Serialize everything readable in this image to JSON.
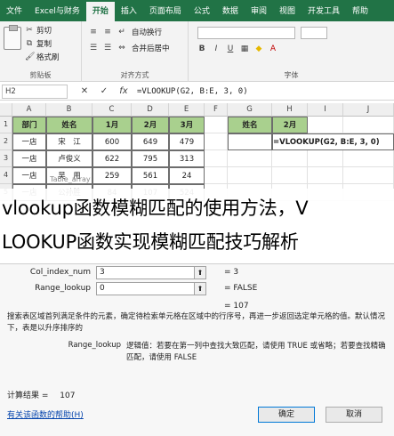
{
  "tabs": [
    "文件",
    "Excel与财务",
    "开始",
    "插入",
    "页面布局",
    "公式",
    "数据",
    "审阅",
    "视图",
    "开发工具",
    "帮助"
  ],
  "ribbon": {
    "clipboard": {
      "cut": "剪切",
      "copy": "复制",
      "format_painter": "格式刷",
      "group_label": "剪贴板"
    },
    "font": {
      "row1_items": [
        "合并后居中"
      ],
      "row2_items": [
        "自动换行"
      ],
      "align_label": "对齐方式",
      "font_label": "字体"
    }
  },
  "formula_bar": {
    "name_box": "H2",
    "cancel": "✕",
    "enter": "✓",
    "fx": "fx",
    "formula": "=VLOOKUP(G2, B:E, 3, 0)"
  },
  "columns": [
    "A",
    "B",
    "C",
    "D",
    "E",
    "F",
    "G",
    "H",
    "I",
    "J"
  ],
  "rows": [
    "1",
    "2",
    "3",
    "4",
    "5"
  ],
  "table": {
    "headers": [
      "部门",
      "姓名",
      "1月",
      "2月",
      "3月"
    ],
    "data": [
      [
        "一店",
        "宋　江",
        "600",
        "649",
        "479"
      ],
      [
        "一店",
        "卢俊义",
        "622",
        "795",
        "313"
      ],
      [
        "一店",
        "吴　用",
        "259",
        "561",
        "24"
      ],
      [
        "一店",
        "公孙胜",
        "84",
        "107",
        "524"
      ]
    ]
  },
  "lookup": {
    "g_header": "姓名",
    "h_header": "2月",
    "h_formula": "=VLOOKUP(G2, B:E, 3, 0)"
  },
  "overlay": {
    "line1": "vlookup函数模糊匹配的使用方法，V",
    "line2": "LOOKUP函数实现模糊匹配技巧解析"
  },
  "dialog": {
    "partial_arg": "Table_array",
    "args": [
      {
        "label": "Col_index_num",
        "value": "3",
        "result": "=  3"
      },
      {
        "label": "Range_lookup",
        "value": "0",
        "result": "=  FALSE"
      }
    ],
    "total_result": "=  107",
    "desc_main": "搜索表区域首列满足条件的元素，确定待检索单元格在区域中的行序号，再进一步返回选定单元格的值。默认情况下，表是以升序排序的",
    "param_name": "Range_lookup",
    "param_desc": "逻辑值：若要在第一列中查找大致匹配，请使用 TRUE 或省略；若要查找精确匹配，请使用 FALSE",
    "calc_label": "计算结果 =",
    "calc_value": "107",
    "help_link": "有关该函数的帮助(H)",
    "ok": "确定",
    "cancel": "取消"
  }
}
